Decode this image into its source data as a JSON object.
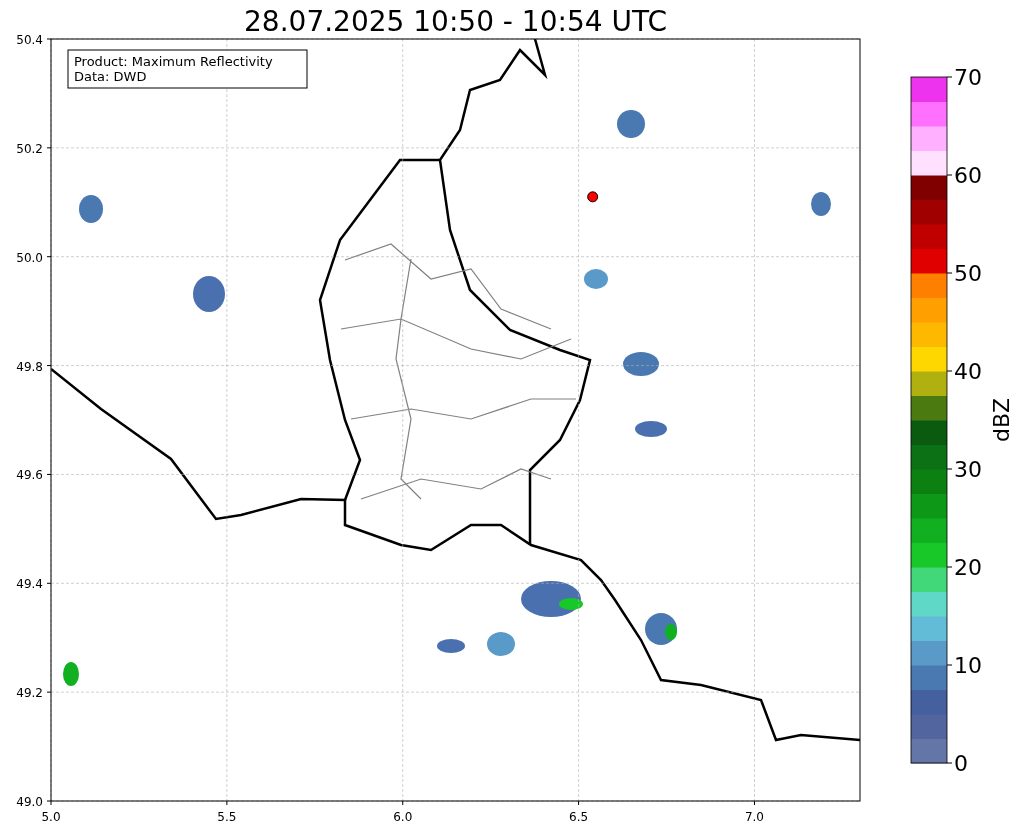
{
  "chart_data": {
    "type": "scatter",
    "title": "28.07.2025 10:50 - 10:54 UTC",
    "xlim": [
      5.0,
      7.3
    ],
    "ylim": [
      49.0,
      50.4
    ],
    "xticks": [
      {
        "value": 5.0,
        "label": "5.0"
      },
      {
        "value": 5.5,
        "label": "5.5"
      },
      {
        "value": 6.0,
        "label": "6.0"
      },
      {
        "value": 6.5,
        "label": "6.5"
      },
      {
        "value": 7.0,
        "label": "7.0"
      }
    ],
    "yticks": [
      {
        "value": 49.0,
        "label": "49.0"
      },
      {
        "value": 49.2,
        "label": "49.2"
      },
      {
        "value": 49.4,
        "label": "49.4"
      },
      {
        "value": 49.6,
        "label": "49.6"
      },
      {
        "value": 49.8,
        "label": "49.8"
      },
      {
        "value": 50.0,
        "label": "50.0"
      },
      {
        "value": 50.2,
        "label": "50.2"
      },
      {
        "value": 50.4,
        "label": "50.4"
      }
    ],
    "grid": true,
    "x": [
      6.54
    ],
    "series": [
      {
        "color": "#ff0000",
        "values": [
          50.11
        ]
      }
    ]
  },
  "info_box": {
    "lines": [
      "Product: Maximum Reflectivity",
      "Data: DWD"
    ]
  },
  "colorbar": {
    "label": "dBZ",
    "ticks": [
      "70",
      "60",
      "50",
      "40",
      "30",
      "20",
      "10",
      "0"
    ],
    "bands": [
      {
        "color": "#6475a8"
      },
      {
        "color": "#53659f"
      },
      {
        "color": "#44609f"
      },
      {
        "color": "#4a78b0"
      },
      {
        "color": "#5a9ac8"
      },
      {
        "color": "#62bcd8"
      },
      {
        "color": "#60d8c8"
      },
      {
        "color": "#40d878"
      },
      {
        "color": "#18c828"
      },
      {
        "color": "#10b020"
      },
      {
        "color": "#0e9818"
      },
      {
        "color": "#0c8010"
      },
      {
        "color": "#0c7014"
      },
      {
        "color": "#0a5a10"
      },
      {
        "color": "#4a7a10"
      },
      {
        "color": "#b0b010"
      },
      {
        "color": "#ffd700"
      },
      {
        "color": "#ffb800"
      },
      {
        "color": "#ffa000"
      },
      {
        "color": "#ff8000"
      },
      {
        "color": "#e00000"
      },
      {
        "color": "#c00000"
      },
      {
        "color": "#a00000"
      },
      {
        "color": "#800000"
      },
      {
        "color": "#ffe0ff"
      },
      {
        "color": "#ffb0ff"
      },
      {
        "color": "#ff70ff"
      },
      {
        "color": "#ee33ee"
      }
    ]
  }
}
